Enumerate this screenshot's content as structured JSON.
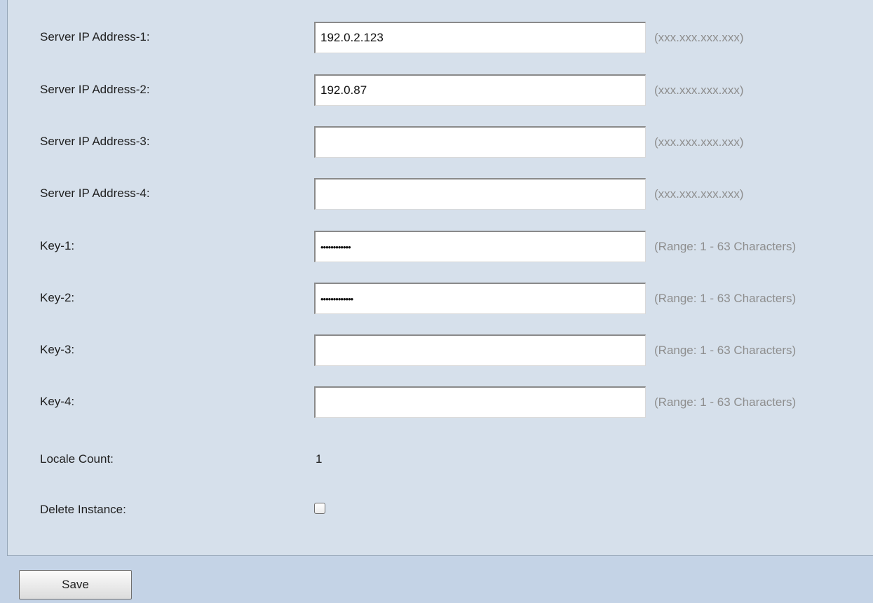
{
  "form": {
    "fields": [
      {
        "label": "Server IP Address-1:",
        "value": "192.0.2.123",
        "hint": "(xxx.xxx.xxx.xxx)",
        "type": "text"
      },
      {
        "label": "Server IP Address-2:",
        "value": "192.0.87",
        "hint": "(xxx.xxx.xxx.xxx)",
        "type": "text"
      },
      {
        "label": "Server IP Address-3:",
        "value": "",
        "hint": "(xxx.xxx.xxx.xxx)",
        "type": "text"
      },
      {
        "label": "Server IP Address-4:",
        "value": "",
        "hint": "(xxx.xxx.xxx.xxx)",
        "type": "text"
      },
      {
        "label": "Key-1:",
        "value": "••••••••••••",
        "hint": "(Range: 1 - 63 Characters)",
        "type": "password"
      },
      {
        "label": "Key-2:",
        "value": "•••••••••••••",
        "hint": "(Range: 1 - 63 Characters)",
        "type": "password"
      },
      {
        "label": "Key-3:",
        "value": "",
        "hint": "(Range: 1 - 63 Characters)",
        "type": "password"
      },
      {
        "label": "Key-4:",
        "value": "",
        "hint": "(Range: 1 - 63 Characters)",
        "type": "password"
      }
    ],
    "locale_count": {
      "label": "Locale Count:",
      "value": "1"
    },
    "delete_instance": {
      "label": "Delete Instance:",
      "checked": false
    }
  },
  "actions": {
    "save_label": "Save"
  }
}
